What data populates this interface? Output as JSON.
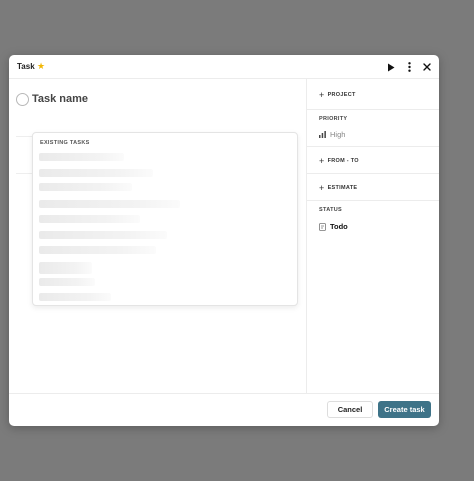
{
  "header": {
    "title": "Task",
    "star_icon": "star-icon",
    "star_color": "#f2b705"
  },
  "task": {
    "name": "Task name"
  },
  "dropdown": {
    "label": "EXISTING TASKS",
    "skeleton_fractions": [
      0.32,
      0.43,
      0.35,
      0.53,
      0.38,
      0.48,
      0.44,
      0.2,
      0.21,
      0.27
    ]
  },
  "sidebar": {
    "project_label": "PROJECT",
    "priority_label": "PRIORITY",
    "priority_value": "High",
    "from_to_label": "FROM - TO",
    "estimate_label": "ESTIMATE",
    "status_label": "STATUS",
    "status_value": "Todo"
  },
  "footer": {
    "cancel_label": "Cancel",
    "create_label": "Create task"
  },
  "colors": {
    "accent": "#3e7388",
    "backdrop": "#7b7b7b"
  }
}
